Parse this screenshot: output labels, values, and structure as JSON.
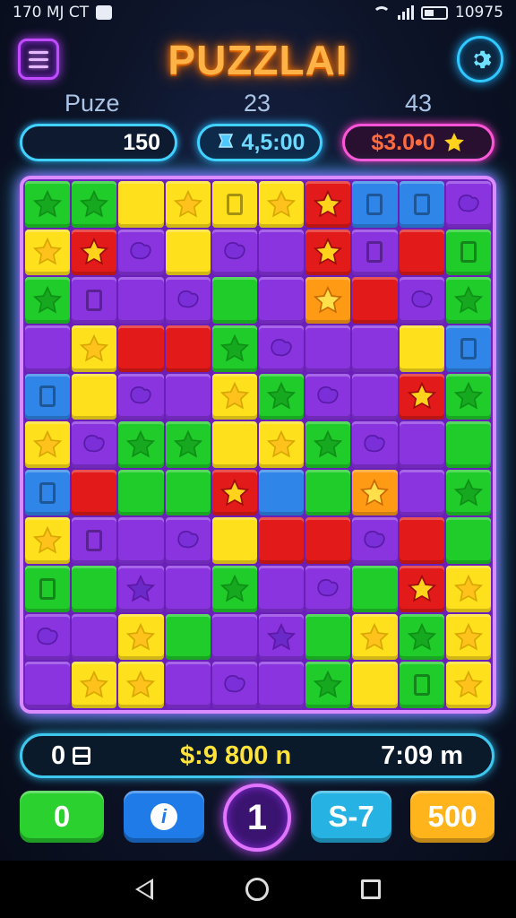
{
  "status_bar": {
    "time_left": "170 MJ CT",
    "right_text": "10975"
  },
  "header": {
    "title": "PUZZLAI"
  },
  "stats": {
    "label1": "Puze",
    "label2": "23",
    "label3": "43",
    "value1": "150",
    "value2": "4,5:00",
    "value3": "$3.0•0"
  },
  "colors": {
    "green": "#1fcc2a",
    "yellow": "#ffe01c",
    "red": "#e21a1a",
    "blue": "#2f86e8",
    "orange": "#ff9a14",
    "purple": "#8a34e0"
  },
  "board": {
    "rows": [
      [
        [
          "green",
          "star"
        ],
        [
          "green",
          "star"
        ],
        [
          "yellow",
          ""
        ],
        [
          "yellow",
          "star"
        ],
        [
          "yellow",
          "rect"
        ],
        [
          "yellow",
          "star"
        ],
        [
          "red",
          "star"
        ],
        [
          "blue",
          "rect"
        ],
        [
          "blue",
          "rect"
        ],
        [
          "purple",
          "gem"
        ]
      ],
      [
        [
          "yellow",
          "star"
        ],
        [
          "red",
          "star"
        ],
        [
          "purple",
          "gem"
        ],
        [
          "yellow",
          ""
        ],
        [
          "purple",
          "gem"
        ],
        [
          "purple",
          ""
        ],
        [
          "red",
          "star"
        ],
        [
          "purple",
          "rect"
        ],
        [
          "red",
          ""
        ],
        [
          "green",
          "rect"
        ]
      ],
      [
        [
          "green",
          "star"
        ],
        [
          "purple",
          "rect"
        ],
        [
          "purple",
          ""
        ],
        [
          "purple",
          "gem"
        ],
        [
          "green",
          ""
        ],
        [
          "purple",
          ""
        ],
        [
          "orange",
          "star"
        ],
        [
          "red",
          ""
        ],
        [
          "purple",
          "gem"
        ],
        [
          "green",
          "star"
        ]
      ],
      [
        [
          "purple",
          ""
        ],
        [
          "yellow",
          "star"
        ],
        [
          "red",
          ""
        ],
        [
          "red",
          ""
        ],
        [
          "green",
          "star"
        ],
        [
          "purple",
          "gem"
        ],
        [
          "purple",
          ""
        ],
        [
          "purple",
          ""
        ],
        [
          "yellow",
          ""
        ],
        [
          "blue",
          "rect"
        ]
      ],
      [
        [
          "blue",
          "rect"
        ],
        [
          "yellow",
          ""
        ],
        [
          "purple",
          "gem"
        ],
        [
          "purple",
          ""
        ],
        [
          "yellow",
          "star"
        ],
        [
          "green",
          "star"
        ],
        [
          "purple",
          "gem"
        ],
        [
          "purple",
          ""
        ],
        [
          "red",
          "star"
        ],
        [
          "green",
          "star"
        ]
      ],
      [
        [
          "yellow",
          "star"
        ],
        [
          "purple",
          "gem"
        ],
        [
          "green",
          "star"
        ],
        [
          "green",
          "star"
        ],
        [
          "yellow",
          ""
        ],
        [
          "yellow",
          "star"
        ],
        [
          "green",
          "star"
        ],
        [
          "purple",
          "gem"
        ],
        [
          "purple",
          ""
        ],
        [
          "green",
          ""
        ]
      ],
      [
        [
          "blue",
          "rect"
        ],
        [
          "red",
          ""
        ],
        [
          "green",
          ""
        ],
        [
          "green",
          ""
        ],
        [
          "red",
          "star"
        ],
        [
          "blue",
          ""
        ],
        [
          "green",
          ""
        ],
        [
          "orange",
          "star"
        ],
        [
          "purple",
          ""
        ],
        [
          "green",
          "star"
        ]
      ],
      [
        [
          "yellow",
          "star"
        ],
        [
          "purple",
          "rect"
        ],
        [
          "purple",
          ""
        ],
        [
          "purple",
          "gem"
        ],
        [
          "yellow",
          ""
        ],
        [
          "red",
          ""
        ],
        [
          "red",
          ""
        ],
        [
          "purple",
          "gem"
        ],
        [
          "red",
          ""
        ],
        [
          "green",
          ""
        ]
      ],
      [
        [
          "green",
          "rect"
        ],
        [
          "green",
          ""
        ],
        [
          "purple",
          "star"
        ],
        [
          "purple",
          ""
        ],
        [
          "green",
          "star"
        ],
        [
          "purple",
          ""
        ],
        [
          "purple",
          "gem"
        ],
        [
          "green",
          ""
        ],
        [
          "red",
          "star"
        ],
        [
          "yellow",
          "star"
        ]
      ],
      [
        [
          "purple",
          "gem"
        ],
        [
          "purple",
          ""
        ],
        [
          "yellow",
          "star"
        ],
        [
          "green",
          ""
        ],
        [
          "purple",
          ""
        ],
        [
          "purple",
          "star"
        ],
        [
          "green",
          ""
        ],
        [
          "yellow",
          "star"
        ],
        [
          "green",
          "star"
        ],
        [
          "yellow",
          "star"
        ]
      ],
      [
        [
          "purple",
          ""
        ],
        [
          "yellow",
          "star"
        ],
        [
          "yellow",
          "star"
        ],
        [
          "purple",
          ""
        ],
        [
          "purple",
          "gem"
        ],
        [
          "purple",
          ""
        ],
        [
          "green",
          "star"
        ],
        [
          "yellow",
          ""
        ],
        [
          "green",
          "rect"
        ],
        [
          "yellow",
          "star"
        ]
      ]
    ]
  },
  "infobar": {
    "left": "0",
    "middle": "$:9 800 n",
    "right": "7:09 m"
  },
  "buttons": {
    "b1": "0",
    "b3": "1",
    "b4": "S-7",
    "b5": "500"
  },
  "icons": {
    "menu": "menu-icon",
    "settings": "gear-icon",
    "timer": "hourglass-icon",
    "coin": "star-icon"
  }
}
